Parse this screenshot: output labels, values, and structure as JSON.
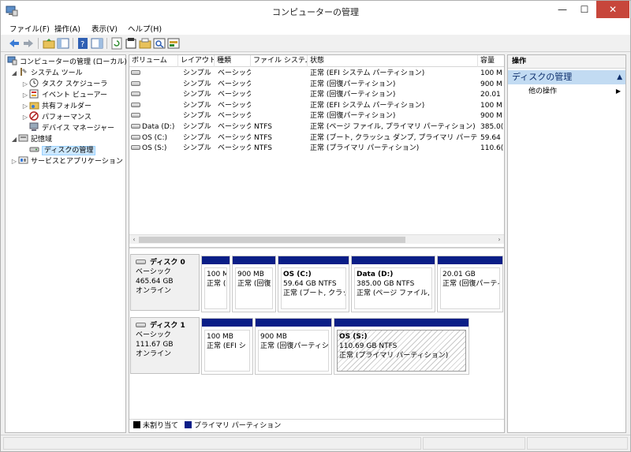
{
  "window": {
    "title": "コンピューターの管理",
    "minimize_glyph": "—",
    "maximize_glyph": "☐",
    "close_glyph": "✕"
  },
  "menu": [
    "ファイル(F)",
    "操作(A)",
    "表示(V)",
    "ヘルプ(H)"
  ],
  "toolbar_icons": [
    "back-icon",
    "forward-icon",
    "up-folder-icon",
    "show-hide-tree-icon",
    "help-icon",
    "show-action-pane-icon",
    "refresh-icon",
    "properties-icon",
    "open-icon",
    "search-icon",
    "rescan-icon"
  ],
  "tree": {
    "root": "コンピューターの管理 (ローカル)",
    "system_tools": "システム ツール",
    "task_scheduler": "タスク スケジューラ",
    "event_viewer": "イベント ビューアー",
    "shared_folders": "共有フォルダー",
    "performance": "パフォーマンス",
    "device_manager": "デバイス マネージャー",
    "storage": "記憶域",
    "disk_management": "ディスクの管理",
    "services_apps": "サービスとアプリケーション"
  },
  "list": {
    "columns": [
      "ボリューム",
      "レイアウト",
      "種類",
      "ファイル システム",
      "状態",
      "容量"
    ],
    "rows": [
      {
        "volume": "",
        "layout": "シンプル",
        "type": "ベーシック",
        "fs": "",
        "status": "正常 (EFI システム パーティション)",
        "capacity": "100 M"
      },
      {
        "volume": "",
        "layout": "シンプル",
        "type": "ベーシック",
        "fs": "",
        "status": "正常 (回復パーティション)",
        "capacity": "900 M"
      },
      {
        "volume": "",
        "layout": "シンプル",
        "type": "ベーシック",
        "fs": "",
        "status": "正常 (回復パーティション)",
        "capacity": "20.01"
      },
      {
        "volume": "",
        "layout": "シンプル",
        "type": "ベーシック",
        "fs": "",
        "status": "正常 (EFI システム パーティション)",
        "capacity": "100 M"
      },
      {
        "volume": "",
        "layout": "シンプル",
        "type": "ベーシック",
        "fs": "",
        "status": "正常 (回復パーティション)",
        "capacity": "900 M"
      },
      {
        "volume": "Data (D:)",
        "layout": "シンプル",
        "type": "ベーシック",
        "fs": "NTFS",
        "status": "正常 (ページ ファイル, プライマリ パーティション)",
        "capacity": "385.0("
      },
      {
        "volume": "OS (C:)",
        "layout": "シンプル",
        "type": "ベーシック",
        "fs": "NTFS",
        "status": "正常 (ブート, クラッシュ ダンプ, プライマリ パーティション)",
        "capacity": "59.64"
      },
      {
        "volume": "OS (S:)",
        "layout": "シンプル",
        "type": "ベーシック",
        "fs": "NTFS",
        "status": "正常 (プライマリ パーティション)",
        "capacity": "110.6("
      }
    ],
    "scroll_left": "‹",
    "scroll_right": "›"
  },
  "disks": [
    {
      "name": "ディスク 0",
      "kind": "ベーシック",
      "size": "465.64 GB",
      "state": "オンライン",
      "partitions": [
        {
          "name": "",
          "size": "100 M",
          "status": "正常 ("
        },
        {
          "name": "",
          "size": "900 MB",
          "status": "正常 (回復"
        },
        {
          "name": "OS  (C:)",
          "size": "59.64 GB NTFS",
          "status": "正常 (ブート, クラッシ"
        },
        {
          "name": "Data  (D:)",
          "size": "385.00 GB NTFS",
          "status": "正常 (ページ ファイル, プ"
        },
        {
          "name": "",
          "size": "20.01 GB",
          "status": "正常 (回復パーティ"
        }
      ]
    },
    {
      "name": "ディスク 1",
      "kind": "ベーシック",
      "size": "111.67 GB",
      "state": "オンライン",
      "partitions": [
        {
          "name": "",
          "size": "100 MB",
          "status": "正常 (EFI シ"
        },
        {
          "name": "",
          "size": "900 MB",
          "status": "正常 (回復パーティショ"
        },
        {
          "name": "OS  (S:)",
          "size": "110.69 GB NTFS",
          "status": "正常 (プライマリ パーティション)"
        }
      ]
    }
  ],
  "legend": {
    "unallocated": "未割り当て",
    "primary": "プライマリ パーティション",
    "unallocated_color": "#000000",
    "primary_color": "#0a1e87"
  },
  "actions": {
    "header": "操作",
    "section": "ディスクの管理",
    "section_arrow": "▲",
    "item": "他の操作",
    "item_arrow": "▶"
  },
  "colors": {
    "partition_bar": "#0a1e87",
    "close_button": "#c7463b",
    "selection": "#cce8ff"
  }
}
